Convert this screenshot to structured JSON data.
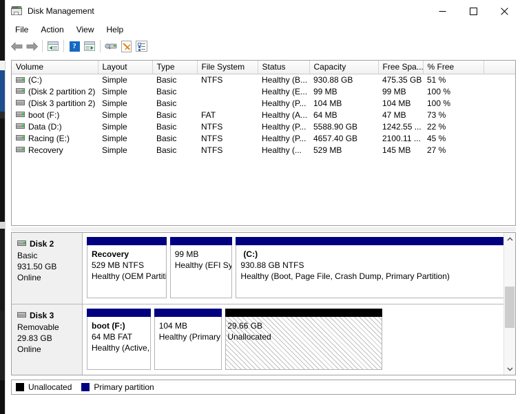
{
  "window": {
    "title": "Disk Management",
    "icon": "disk-management-icon",
    "controls": {
      "minimize": "–",
      "maximize": "□",
      "close": "✕"
    }
  },
  "menu": {
    "items": [
      "File",
      "Action",
      "View",
      "Help"
    ]
  },
  "toolbar": {
    "buttons": [
      {
        "name": "back-icon",
        "label": "Back"
      },
      {
        "name": "forward-icon",
        "label": "Forward"
      },
      {
        "name": "show-hide-console-tree-icon",
        "label": "Show/Hide Console Tree"
      },
      {
        "name": "help-icon",
        "label": "Help"
      },
      {
        "name": "show-hide-action-pane-icon",
        "label": "Show/Hide Action Pane"
      },
      {
        "name": "rescan-disks-icon",
        "label": "Rescan Disks"
      },
      {
        "name": "properties-icon",
        "label": "Properties"
      },
      {
        "name": "options-icon",
        "label": "Options"
      }
    ]
  },
  "volume_list": {
    "columns": [
      "Volume",
      "Layout",
      "Type",
      "File System",
      "Status",
      "Capacity",
      "Free Spa...",
      "% Free"
    ],
    "rows": [
      {
        "icon": "drive-icon",
        "volume": "(C:)",
        "layout": "Simple",
        "type": "Basic",
        "file_system": "NTFS",
        "status": "Healthy (B...",
        "capacity": "930.88 GB",
        "free_space": "475.35 GB",
        "percent_free": "51 %"
      },
      {
        "icon": "drive-icon",
        "volume": "(Disk 2 partition 2)",
        "layout": "Simple",
        "type": "Basic",
        "file_system": "",
        "status": "Healthy (E...",
        "capacity": "99 MB",
        "free_space": "99 MB",
        "percent_free": "100 %"
      },
      {
        "icon": "drive-icon-gray",
        "volume": "(Disk 3 partition 2)",
        "layout": "Simple",
        "type": "Basic",
        "file_system": "",
        "status": "Healthy (P...",
        "capacity": "104 MB",
        "free_space": "104 MB",
        "percent_free": "100 %"
      },
      {
        "icon": "drive-icon",
        "volume": "boot (F:)",
        "layout": "Simple",
        "type": "Basic",
        "file_system": "FAT",
        "status": "Healthy (A...",
        "capacity": "64 MB",
        "free_space": "47 MB",
        "percent_free": "73 %"
      },
      {
        "icon": "drive-icon",
        "volume": "Data (D:)",
        "layout": "Simple",
        "type": "Basic",
        "file_system": "NTFS",
        "status": "Healthy (P...",
        "capacity": "5588.90 GB",
        "free_space": "1242.55 ...",
        "percent_free": "22 %"
      },
      {
        "icon": "drive-icon",
        "volume": "Racing (E:)",
        "layout": "Simple",
        "type": "Basic",
        "file_system": "NTFS",
        "status": "Healthy (P...",
        "capacity": "4657.40 GB",
        "free_space": "2100.11 ...",
        "percent_free": "45 %"
      },
      {
        "icon": "drive-icon",
        "volume": "Recovery",
        "layout": "Simple",
        "type": "Basic",
        "file_system": "NTFS",
        "status": "Healthy (...",
        "capacity": "529 MB",
        "free_space": "145 MB",
        "percent_free": "27 %"
      }
    ]
  },
  "graphical_view": {
    "disks": [
      {
        "name": "Disk 2",
        "type": "Basic",
        "size": "931.50 GB",
        "state": "Online",
        "partitions": [
          {
            "kind": "primary",
            "title": "Recovery",
            "size_fs": "529 MB NTFS",
            "status": "Healthy (OEM Partition)",
            "width_pct": 18.5
          },
          {
            "kind": "primary",
            "title": "",
            "size_fs": "99 MB",
            "status": "Healthy (EFI System Partition)",
            "width_pct": 14.5
          },
          {
            "kind": "primary",
            "title": "(C:)",
            "size_fs": "930.88 GB NTFS",
            "status": "Healthy (Boot, Page File, Crash Dump, Primary Partition)",
            "width_pct": 67
          }
        ]
      },
      {
        "name": "Disk 3",
        "type": "Removable",
        "size": "29.83 GB",
        "state": "Online",
        "partitions": [
          {
            "kind": "primary",
            "title": "boot  (F:)",
            "size_fs": "64 MB FAT",
            "status": "Healthy (Active, Primary Partition)",
            "width_pct": 15.5
          },
          {
            "kind": "primary",
            "title": "",
            "size_fs": "104 MB",
            "status": "Healthy (Primary Partition)",
            "width_pct": 16.5
          },
          {
            "kind": "unallocated",
            "title": "29.66 GB",
            "size_fs": "Unallocated",
            "status": "",
            "width_pct": 38
          }
        ]
      }
    ]
  },
  "legend": {
    "items": [
      {
        "color": "#000000",
        "label": "Unallocated",
        "swatch": "black"
      },
      {
        "color": "#000080",
        "label": "Primary partition",
        "swatch": "blue"
      }
    ]
  },
  "colors": {
    "primary_partition": "#000080",
    "unallocated": "#000000",
    "window_chrome": "#f0f0f0",
    "accent_help": "#1668c3"
  }
}
